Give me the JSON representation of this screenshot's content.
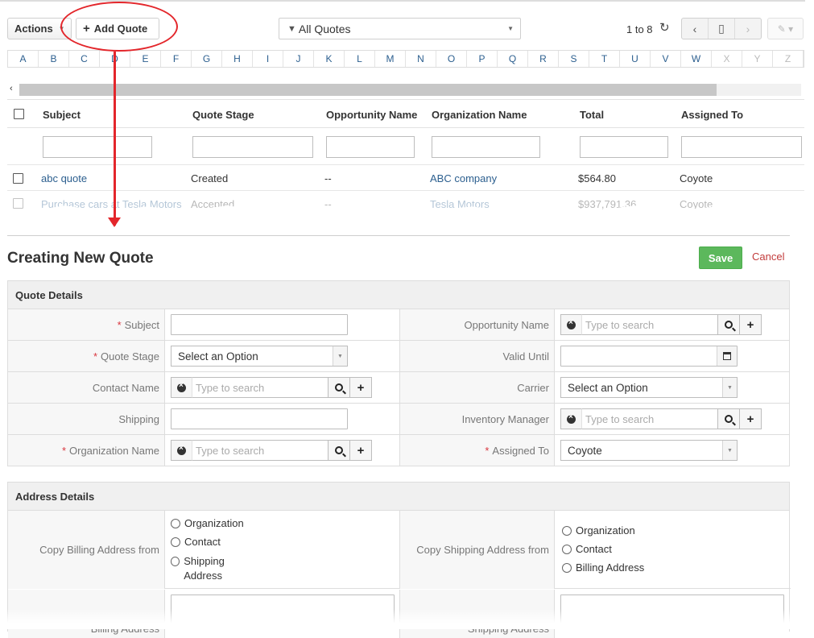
{
  "toolbar": {
    "actions_label": "Actions",
    "add_quote_label": "Add Quote",
    "filter_label": "All Quotes",
    "pager_text": "1 to 8"
  },
  "alphabet": [
    "A",
    "B",
    "C",
    "D",
    "E",
    "F",
    "G",
    "H",
    "I",
    "J",
    "K",
    "L",
    "M",
    "N",
    "O",
    "P",
    "Q",
    "R",
    "S",
    "T",
    "U",
    "V",
    "W",
    "X",
    "Y",
    "Z"
  ],
  "list": {
    "columns": [
      "Subject",
      "Quote Stage",
      "Opportunity Name",
      "Organization Name",
      "Total",
      "Assigned To"
    ],
    "rows": [
      {
        "subject": "abc quote",
        "stage": "Created",
        "opportunity": "--",
        "organization": "ABC company",
        "total": "$564.80",
        "assigned": "Coyote"
      },
      {
        "subject": "Purchase cars at Tesla Motors",
        "stage": "Accepted",
        "opportunity": "--",
        "organization": "Tesla Motors",
        "total": "$937,791.36",
        "assigned": "Coyote"
      }
    ]
  },
  "form": {
    "title": "Creating New Quote",
    "save_label": "Save",
    "cancel_label": "Cancel",
    "quote_details_title": "Quote Details",
    "address_details_title": "Address Details",
    "fields": {
      "subject": "Subject",
      "quote_stage": "Quote Stage",
      "contact_name": "Contact Name",
      "shipping": "Shipping",
      "organization_name": "Organization Name",
      "opportunity_name": "Opportunity Name",
      "valid_until": "Valid Until",
      "carrier": "Carrier",
      "inventory_manager": "Inventory Manager",
      "assigned_to": "Assigned To"
    },
    "required_mark": "*",
    "select_placeholder": "Select an Option",
    "search_placeholder": "Type to search",
    "assigned_value": "Coyote",
    "copy_billing_label": "Copy Billing Address from",
    "copy_shipping_label": "Copy Shipping Address from",
    "billing_options": [
      "Organization",
      "Contact",
      "Shipping Address"
    ],
    "shipping_options": [
      "Organization",
      "Contact",
      "Billing Address"
    ],
    "billing_address_label": "Billing Address",
    "shipping_address_label": "Shipping Address"
  },
  "colors": {
    "link": "#2c5f8f",
    "save": "#5cb85c",
    "annotation": "#e3262b",
    "cancel": "#c23b3b"
  }
}
